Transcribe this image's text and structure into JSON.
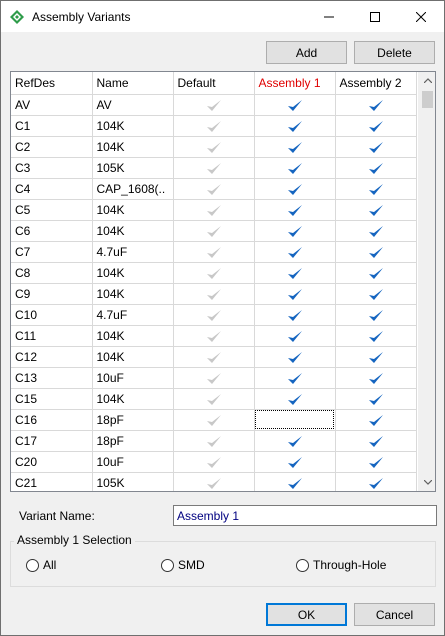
{
  "window": {
    "title": "Assembly Variants"
  },
  "toolbar": {
    "add_label": "Add",
    "delete_label": "Delete"
  },
  "grid": {
    "columns": [
      "RefDes",
      "Name",
      "Default",
      "Assembly 1",
      "Assembly 2"
    ],
    "active_column": "Assembly 1",
    "rows": [
      {
        "ref": "AV",
        "name": "AV",
        "default": true,
        "a1": true,
        "a2": true
      },
      {
        "ref": "C1",
        "name": "104K",
        "default": true,
        "a1": true,
        "a2": true
      },
      {
        "ref": "C2",
        "name": "104K",
        "default": true,
        "a1": true,
        "a2": true
      },
      {
        "ref": "C3",
        "name": "105K",
        "default": true,
        "a1": true,
        "a2": true
      },
      {
        "ref": "C4",
        "name": "CAP_1608(..",
        "default": true,
        "a1": true,
        "a2": true
      },
      {
        "ref": "C5",
        "name": "104K",
        "default": true,
        "a1": true,
        "a2": true
      },
      {
        "ref": "C6",
        "name": "104K",
        "default": true,
        "a1": true,
        "a2": true
      },
      {
        "ref": "C7",
        "name": "4.7uF",
        "default": true,
        "a1": true,
        "a2": true
      },
      {
        "ref": "C8",
        "name": "104K",
        "default": true,
        "a1": true,
        "a2": true
      },
      {
        "ref": "C9",
        "name": "104K",
        "default": true,
        "a1": true,
        "a2": true
      },
      {
        "ref": "C10",
        "name": "4.7uF",
        "default": true,
        "a1": true,
        "a2": true
      },
      {
        "ref": "C11",
        "name": "104K",
        "default": true,
        "a1": true,
        "a2": true
      },
      {
        "ref": "C12",
        "name": "104K",
        "default": true,
        "a1": true,
        "a2": true
      },
      {
        "ref": "C13",
        "name": "10uF",
        "default": true,
        "a1": true,
        "a2": true
      },
      {
        "ref": "C15",
        "name": "104K",
        "default": true,
        "a1": true,
        "a2": true
      },
      {
        "ref": "C16",
        "name": "18pF",
        "default": true,
        "a1": false,
        "a2": true
      },
      {
        "ref": "C17",
        "name": "18pF",
        "default": true,
        "a1": true,
        "a2": true
      },
      {
        "ref": "C20",
        "name": "10uF",
        "default": true,
        "a1": true,
        "a2": true
      },
      {
        "ref": "C21",
        "name": "105K",
        "default": true,
        "a1": true,
        "a2": true
      }
    ]
  },
  "variant": {
    "label": "Variant Name:",
    "value": "Assembly 1"
  },
  "selection": {
    "legend": "Assembly 1 Selection",
    "options": [
      "All",
      "SMD",
      "Through-Hole"
    ]
  },
  "footer": {
    "ok_label": "OK",
    "cancel_label": "Cancel"
  },
  "colors": {
    "check_default": "#c8c8c8",
    "check_active": "#1565c0",
    "active_header": "#e00000"
  }
}
